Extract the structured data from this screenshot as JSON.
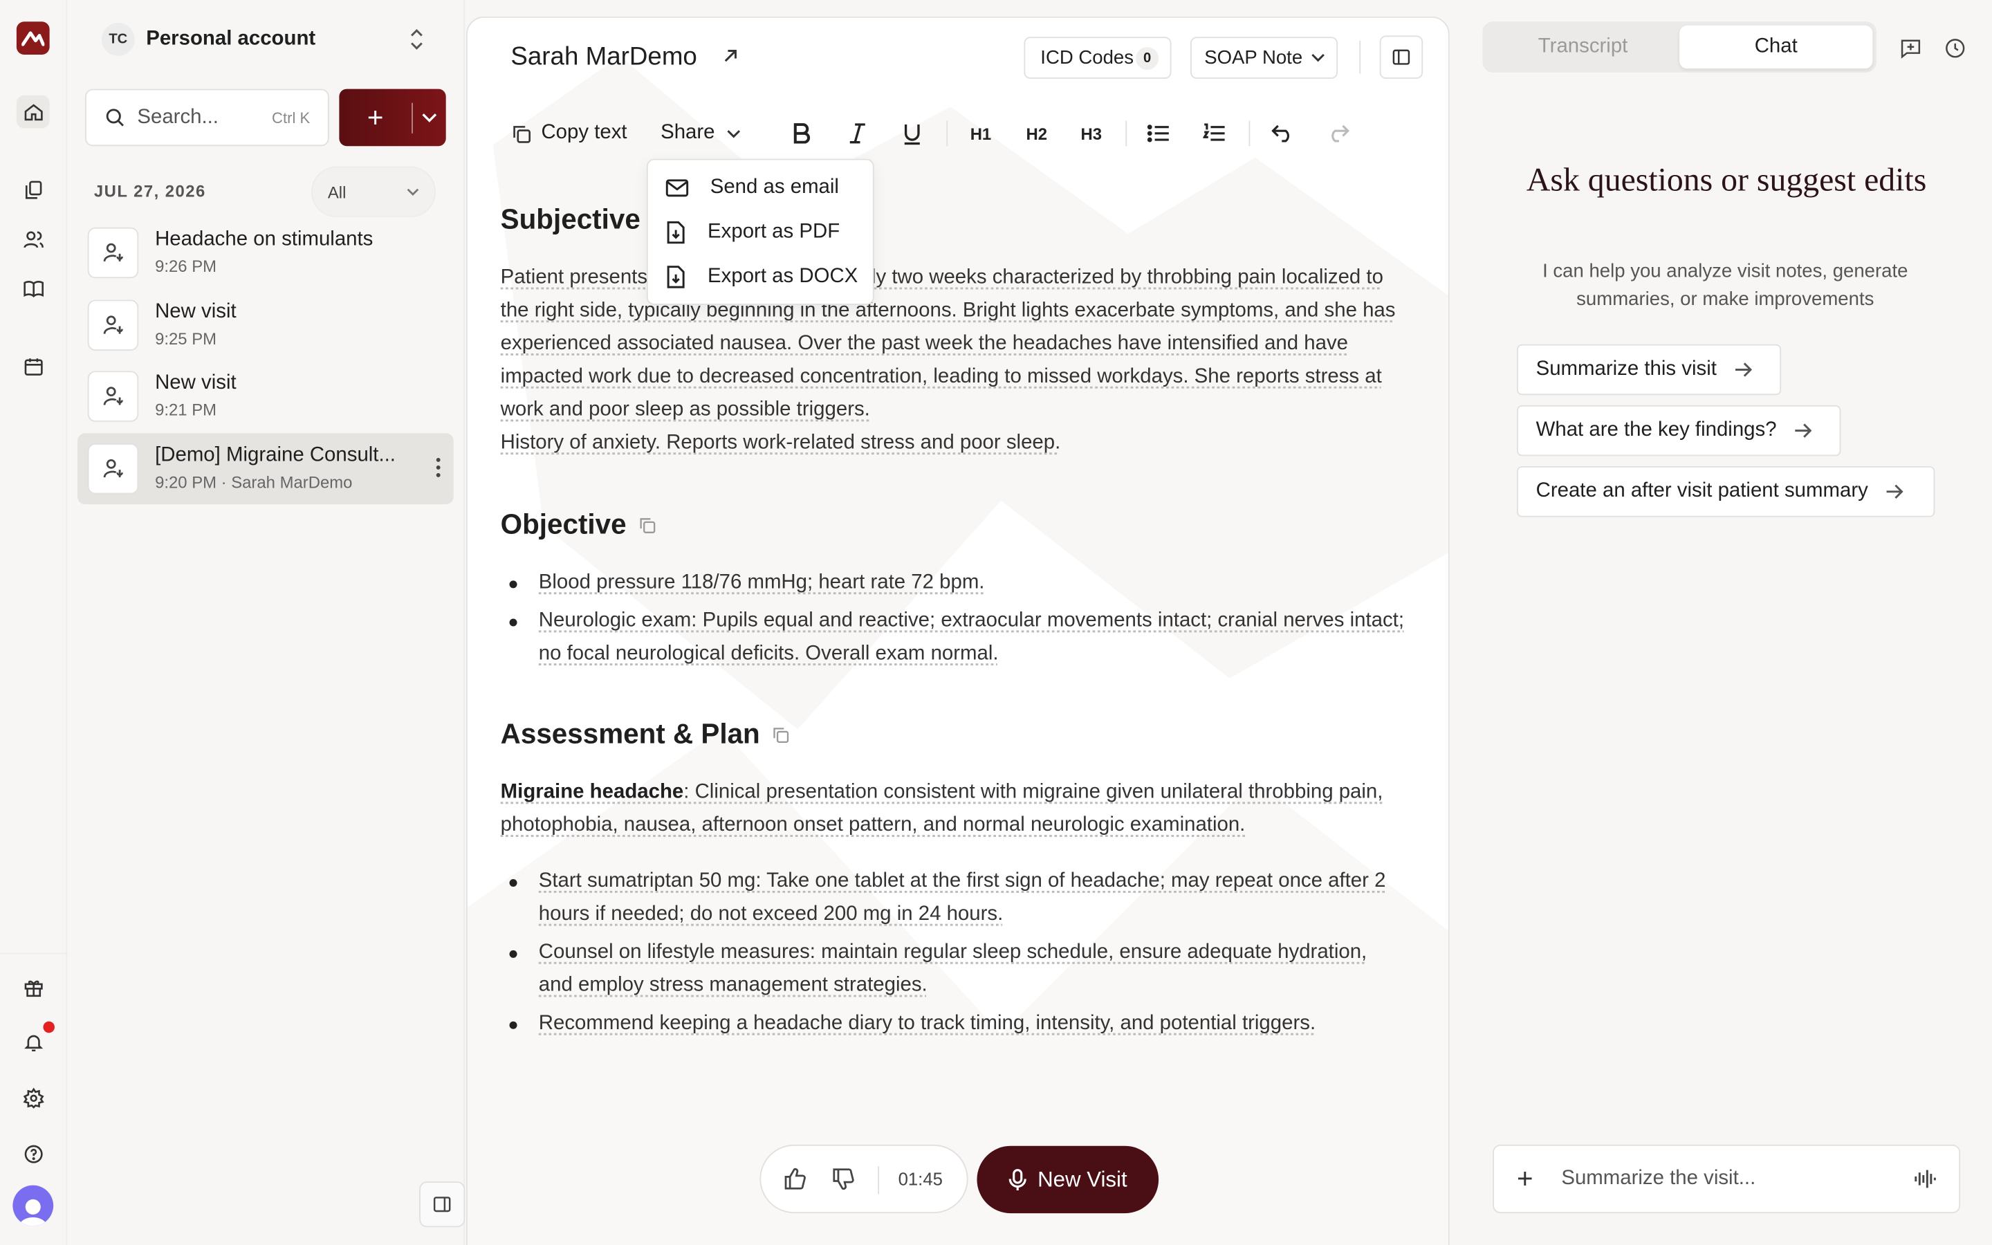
{
  "account": {
    "initials": "TC",
    "name": "Personal account"
  },
  "search": {
    "placeholder": "Search...",
    "shortcut": "Ctrl K"
  },
  "visits": {
    "date": "JUL 27, 2026",
    "filter": "All",
    "items": [
      {
        "title": "Headache on stimulants",
        "subtitle": "9:26 PM"
      },
      {
        "title": "New visit",
        "subtitle": "9:25 PM"
      },
      {
        "title": "New visit",
        "subtitle": "9:21 PM"
      },
      {
        "title": "[Demo] Migraine Consult...",
        "subtitle": "9:20 PM · Sarah MarDemo"
      }
    ]
  },
  "header": {
    "patient": "Sarah MarDemo",
    "icd_label": "ICD Codes",
    "icd_count": "0",
    "template": "SOAP Note"
  },
  "toolbar": {
    "copy": "Copy text",
    "share": "Share",
    "h1": "H1",
    "h2": "H2",
    "h3": "H3"
  },
  "share_menu": [
    "Send as email",
    "Export as PDF",
    "Export as DOCX"
  ],
  "note": {
    "subjective_title": "Subjective",
    "subjective_text_a": "Patient presents",
    "subjective_text_b": "roximately two weeks characterized by throbbing pain localized to the right side, typically beginning in the afternoons. Bright lights exacerbate symptoms, and she has experienced associated nausea. Over the past week the headaches have intensified and have impacted work due to decreased concentration, leading to missed workdays. She reports stress at work and poor sleep as possible triggers.",
    "subjective_history": "History of anxiety. Reports work-related stress and poor sleep.",
    "objective_title": "Objective",
    "objective_items": [
      "Blood pressure 118/76 mmHg; heart rate 72 bpm.",
      "Neurologic exam: Pupils equal and reactive; extraocular movements intact; cranial nerves intact; no focal neurological deficits. Overall exam normal."
    ],
    "plan_title": "Assessment & Plan",
    "plan_dx": "Migraine headache",
    "plan_dx_text": ": Clinical presentation consistent with migraine given unilateral throbbing pain, photophobia, nausea, afternoon onset pattern, and normal neurologic examination.",
    "plan_items": [
      "Start sumatriptan 50 mg: Take one tablet at the first sign of headache; may repeat once after 2 hours if needed; do not exceed 200 mg in 24 hours.",
      "Counsel on lifestyle measures: maintain regular sleep schedule, ensure adequate hydration, and employ stress management strategies.",
      "Recommend keeping a headache diary to track timing, intensity, and potential triggers."
    ]
  },
  "recorder": {
    "timer": "01:45",
    "new_visit": "New Visit"
  },
  "chat": {
    "tab_transcript": "Transcript",
    "tab_chat": "Chat",
    "heading": "Ask questions or suggest edits",
    "subheading": "I can help you analyze visit notes, generate summaries, or make improvements",
    "suggestions": [
      "Summarize this visit",
      "What are the key findings?",
      "Create an after visit patient summary"
    ],
    "input_placeholder": "Summarize the visit..."
  },
  "colors": {
    "brand": "#8b1a1a",
    "primary_button": "#4a0f14",
    "notification": "#e52020"
  }
}
